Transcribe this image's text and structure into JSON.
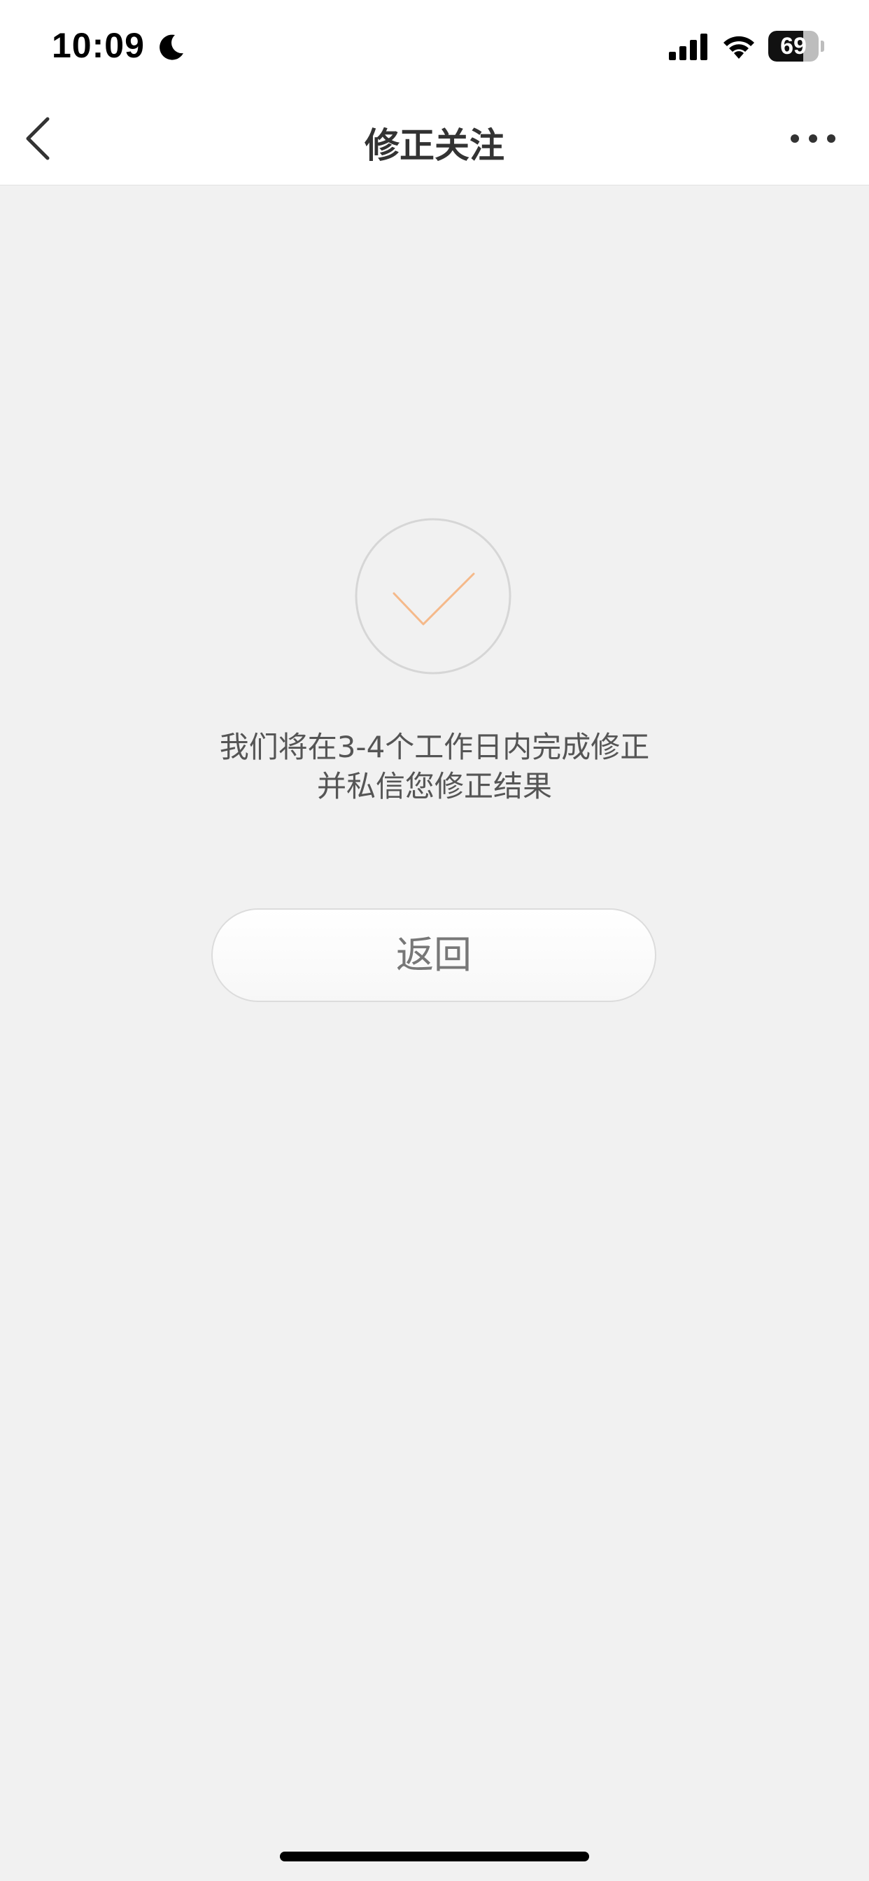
{
  "status_bar": {
    "time": "10:09",
    "battery_level": "69",
    "battery_fraction": 0.69,
    "icons": [
      "moon-icon",
      "signal-icon",
      "wifi-icon",
      "battery-icon"
    ]
  },
  "nav": {
    "title": "修正关注",
    "back_icon": "chevron-left-icon",
    "more_icon": "more-dots-icon"
  },
  "content": {
    "success_icon": "check-icon",
    "check_color": "#f5b98a",
    "message_line1": "我们将在3-4个工作日内完成修正",
    "message_line2": "并私信您修正结果",
    "return_label": "返回"
  }
}
